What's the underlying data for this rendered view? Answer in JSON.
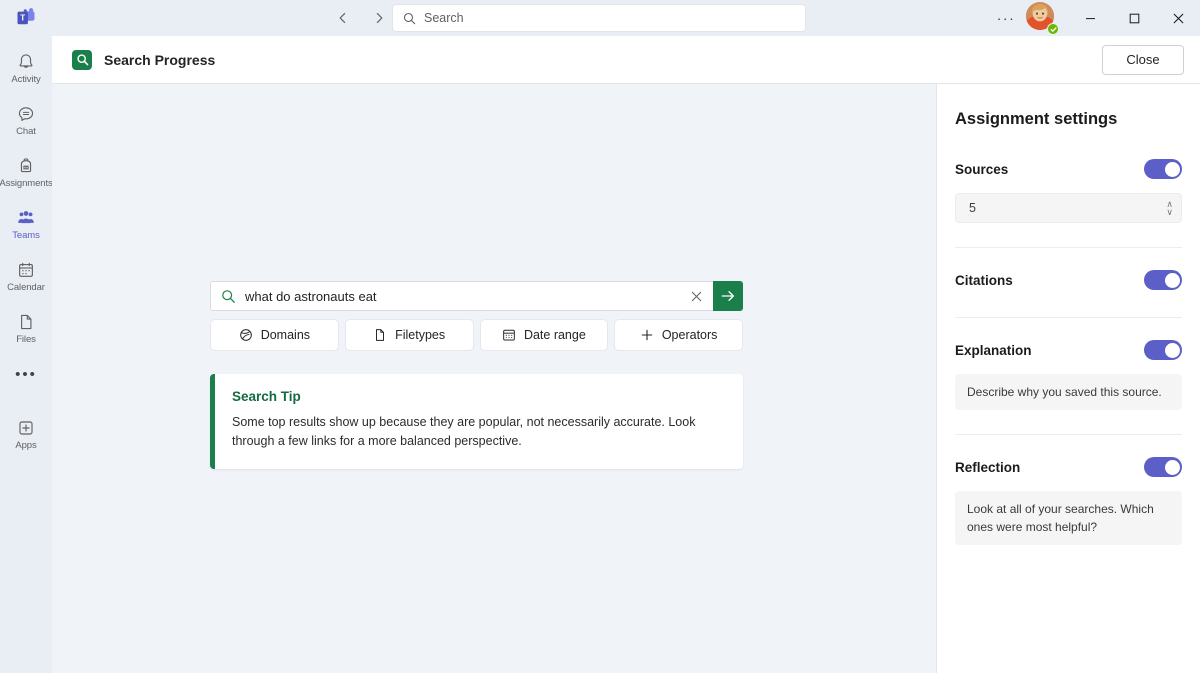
{
  "window": {
    "logo_name": "microsoft-teams-logo",
    "nav_back_label": "‹",
    "nav_forward_label": "›",
    "top_search_placeholder": "Search",
    "more_options_label": "···",
    "minimize_label": "─",
    "maximize_label": "☐",
    "close_label": "✕",
    "presence_status": "Available"
  },
  "rail": {
    "items": [
      {
        "label": "Activity",
        "icon": "bell-icon",
        "active": false
      },
      {
        "label": "Chat",
        "icon": "chat-icon",
        "active": false
      },
      {
        "label": "Assignments",
        "icon": "backpack-icon",
        "active": false
      },
      {
        "label": "Teams",
        "icon": "people-icon",
        "active": true
      },
      {
        "label": "Calendar",
        "icon": "calendar-icon",
        "active": false
      },
      {
        "label": "Files",
        "icon": "file-icon",
        "active": false
      }
    ],
    "more_label": "•••",
    "apps_label": "Apps"
  },
  "app_header": {
    "icon": "search-app-icon",
    "title": "Search Progress",
    "close_label": "Close"
  },
  "search": {
    "icon": "search-icon",
    "value": "what do astronauts eat",
    "clear_label": "✕",
    "submit_label": "→",
    "filters": [
      {
        "label": "Domains",
        "icon": "globe-icon"
      },
      {
        "label": "Filetypes",
        "icon": "document-icon"
      },
      {
        "label": "Date range",
        "icon": "calendar-icon"
      },
      {
        "label": "Operators",
        "icon": "plus-icon"
      }
    ]
  },
  "tip": {
    "title": "Search Tip",
    "body": "Some top results show up because they are popular, not necessarily accurate. Look through a few links for a more balanced perspective."
  },
  "panel": {
    "title": "Assignment settings",
    "settings": [
      {
        "label": "Sources",
        "toggle_on": true,
        "spinner_value": "5",
        "spinner_up": "∧",
        "spinner_down": "∨"
      },
      {
        "label": "Citations",
        "toggle_on": true
      },
      {
        "label": "Explanation",
        "toggle_on": true,
        "note": "Describe why you saved this source."
      },
      {
        "label": "Reflection",
        "toggle_on": true,
        "note": "Look at all of your searches. Which ones were most helpful?"
      }
    ]
  },
  "colors": {
    "teams_purple": "#5b5fc7",
    "app_green": "#1a7f4b",
    "tip_green": "#156b41",
    "presence_green": "#6bb700",
    "canvas": "#f0f3f8",
    "rail_bg": "#e9edf4"
  }
}
